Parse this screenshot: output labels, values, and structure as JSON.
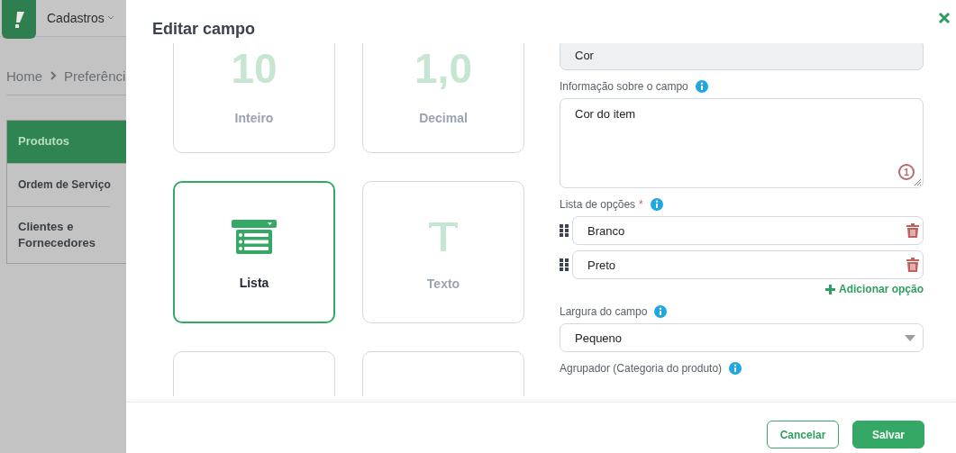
{
  "background": {
    "menu": "Cadastros",
    "breadcrumb": [
      "Home",
      "Preferênci"
    ],
    "sidebar": [
      {
        "label": "Produtos",
        "selected": true
      },
      {
        "label": "Ordem de Serviço",
        "selected": false
      },
      {
        "label": "Clientes e Fornecedores",
        "selected": false
      }
    ]
  },
  "dialog": {
    "title": "Editar campo"
  },
  "field_types": [
    {
      "kind": "number",
      "symbol": "10",
      "label": "Inteiro",
      "selected": false
    },
    {
      "kind": "number",
      "symbol": "1,0",
      "label": "Decimal",
      "selected": false
    },
    {
      "kind": "list",
      "label": "Lista",
      "selected": true
    },
    {
      "kind": "text",
      "label": "Texto",
      "selected": false
    },
    {
      "kind": "cut_off",
      "selected": false
    },
    {
      "kind": "cut_off",
      "selected": false
    }
  ],
  "form": {
    "name_value": "Cor",
    "info": {
      "label": "Informação sobre o campo",
      "value": "Cor do item",
      "badge": "1"
    },
    "options": {
      "label": "Lista de opções",
      "required_mark": "*",
      "items": [
        "Branco",
        "Preto"
      ],
      "add": "Adicionar opção"
    },
    "width": {
      "label": "Largura do campo",
      "value": "Pequeno"
    },
    "group": {
      "label": "Agrupador (Categoria do produto)"
    }
  },
  "buttons": [
    {
      "kind": "secondary",
      "label": "Cancelar"
    },
    {
      "kind": "primary",
      "label": "Salvar"
    }
  ]
}
